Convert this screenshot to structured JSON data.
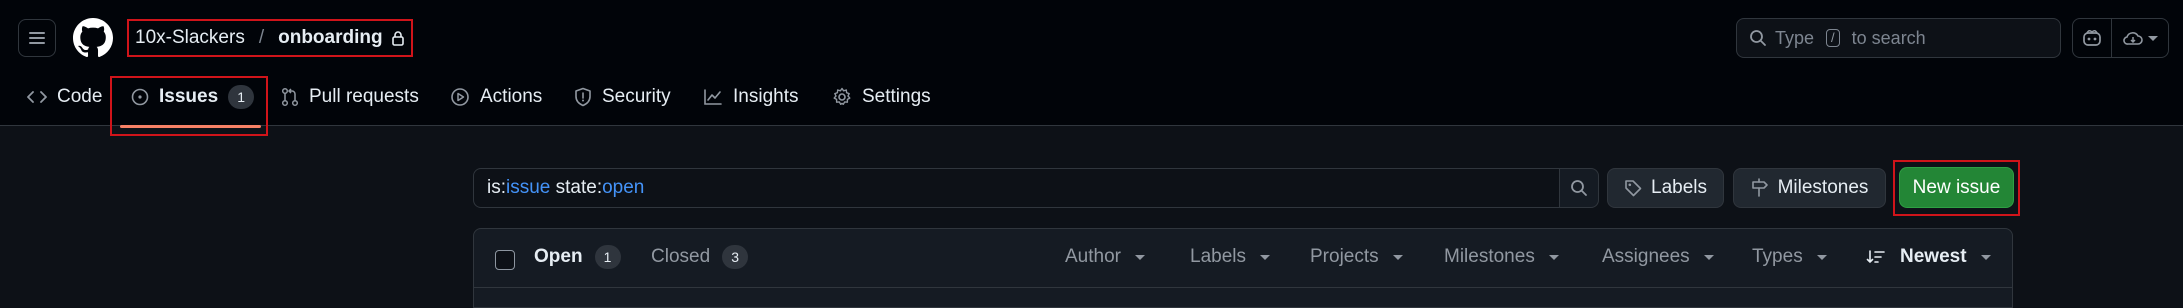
{
  "header": {
    "owner": "10x-Slackers",
    "separator": "/",
    "repo": "onboarding",
    "search_prefix": "Type",
    "search_key": "/",
    "search_suffix": "to search"
  },
  "tabs": [
    {
      "label": "Code",
      "icon": "code-icon"
    },
    {
      "label": "Issues",
      "icon": "issue-opened-icon",
      "count": "1"
    },
    {
      "label": "Pull requests",
      "icon": "git-pull-request-icon"
    },
    {
      "label": "Actions",
      "icon": "play-icon"
    },
    {
      "label": "Security",
      "icon": "shield-icon"
    },
    {
      "label": "Insights",
      "icon": "graph-icon"
    },
    {
      "label": "Settings",
      "icon": "gear-icon"
    }
  ],
  "filter": {
    "is_key": "is:",
    "is_value": "issue",
    "state_key": " state:",
    "state_value": "open"
  },
  "buttons": {
    "labels": "Labels",
    "milestones": "Milestones",
    "new_issue": "New issue"
  },
  "list_header": {
    "open_label": "Open",
    "open_count": "1",
    "closed_label": "Closed",
    "closed_count": "3",
    "filters": [
      "Author",
      "Labels",
      "Projects",
      "Milestones",
      "Assignees",
      "Types"
    ],
    "sort": "Newest"
  },
  "colors": {
    "accent_blue": "#4493f8",
    "primary_green": "#238636",
    "tab_underline": "#f78166"
  }
}
